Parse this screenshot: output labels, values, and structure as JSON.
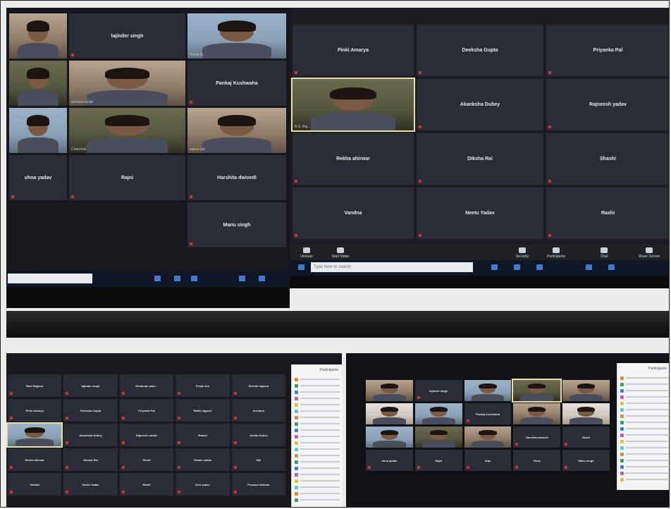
{
  "collage": {
    "top_left": {
      "tiles": [
        {
          "label": "",
          "video": true
        },
        {
          "label": "tajinder singh",
          "video": false
        },
        {
          "label": "",
          "video": true,
          "caption": "Vishal G..."
        },
        {
          "label": "",
          "video": true
        },
        {
          "label": "",
          "video": true,
          "caption": "archana singh"
        },
        {
          "label": "Pankaj Kushwaha",
          "video": false
        },
        {
          "label": "",
          "video": true
        },
        {
          "label": "",
          "video": true,
          "caption": "Chanchal"
        },
        {
          "label": "",
          "video": true,
          "caption": "sapna pal"
        },
        {
          "label": "uhna yadav",
          "video": false
        },
        {
          "label": "Rajni",
          "video": false
        },
        {
          "label": "Harshita dwivedi",
          "video": false
        },
        {
          "label": "",
          "video": false,
          "empty": true
        },
        {
          "label": "",
          "video": false,
          "empty": true
        },
        {
          "label": "Manu singh",
          "video": false
        }
      ]
    },
    "top_right": {
      "tiles": [
        {
          "label": "Pinki Amarya",
          "video": false
        },
        {
          "label": "Deeksha Gupta",
          "video": false
        },
        {
          "label": "Priyanka Pal",
          "video": false
        },
        {
          "label": "",
          "video": true,
          "selected": true,
          "caption": "B.S. Raj..."
        },
        {
          "label": "Akanksha Dubey",
          "video": false
        },
        {
          "label": "Rajneesh yadav",
          "video": false
        },
        {
          "label": "Rekha ahirwar",
          "video": false
        },
        {
          "label": "Diksha Rai",
          "video": false
        },
        {
          "label": "Shashi",
          "video": false
        },
        {
          "label": "Vandna",
          "video": false
        },
        {
          "label": "Neetu Yadav",
          "video": false
        },
        {
          "label": "Rashi",
          "video": false
        }
      ],
      "toolbar": [
        "Unmute",
        "Start Video",
        "Security",
        "Participants",
        "Chat",
        "Share Screen"
      ],
      "search_placeholder": "Type here to search"
    },
    "bottom_left": {
      "tiles": [
        {
          "label": "Ravi Rajpoot",
          "video": false
        },
        {
          "label": "tajinder singh",
          "video": false
        },
        {
          "label": "Himanshi yadv...",
          "video": false
        },
        {
          "label": "Pooja Jha",
          "video": false
        },
        {
          "label": "Shruthi rajpoot",
          "video": false
        },
        {
          "label": "Pinki Amarya",
          "video": false
        },
        {
          "label": "Deeksha Gupta",
          "video": false
        },
        {
          "label": "Priyanka Pal",
          "video": false
        },
        {
          "label": "Rakhi rajpoot",
          "video": false
        },
        {
          "label": "Archana",
          "video": false
        },
        {
          "label": "",
          "video": true,
          "selected": true
        },
        {
          "label": "Akanksha Dubey",
          "video": false
        },
        {
          "label": "Rajneesh yadav",
          "video": false
        },
        {
          "label": "Shashi",
          "video": false
        },
        {
          "label": "Ankita Dubey",
          "video": false
        },
        {
          "label": "Rekha ahirwar",
          "video": false
        },
        {
          "label": "Diksha Rai",
          "video": false
        },
        {
          "label": "Shruti",
          "video": false
        },
        {
          "label": "Vikash yadav",
          "video": false
        },
        {
          "label": "Niti",
          "video": false
        },
        {
          "label": "Vandna",
          "video": false
        },
        {
          "label": "Neetu Yadav",
          "video": false
        },
        {
          "label": "Rashi",
          "video": false
        },
        {
          "label": "Kirti yadav",
          "video": false
        },
        {
          "label": "Poonam ahirwar",
          "video": false
        }
      ],
      "panel_title": "Participants"
    },
    "bottom_right": {
      "tiles": [
        {
          "label": "",
          "video": true
        },
        {
          "label": "tajinder singh",
          "video": false
        },
        {
          "label": "",
          "video": true
        },
        {
          "label": "",
          "video": true,
          "selected": true
        },
        {
          "label": "",
          "video": true
        },
        {
          "label": "",
          "video": true
        },
        {
          "label": "",
          "video": true
        },
        {
          "label": "Pankaj Kushwaha",
          "video": false
        },
        {
          "label": "",
          "video": true
        },
        {
          "label": "",
          "video": true
        },
        {
          "label": "",
          "video": true
        },
        {
          "label": "",
          "video": true
        },
        {
          "label": "",
          "video": true
        },
        {
          "label": "Harshita dwivedi",
          "video": false
        },
        {
          "label": "Rashi",
          "video": false
        },
        {
          "label": "uhna yadav",
          "video": false
        },
        {
          "label": "Rajni",
          "video": false
        },
        {
          "label": "Anju",
          "video": false
        },
        {
          "label": "Vikas",
          "video": false
        },
        {
          "label": "Manu singh",
          "video": false
        }
      ],
      "panel_title": "Participants"
    }
  },
  "colors": {
    "tile": "#2a2d35",
    "toolbar": "#1f2127",
    "accent": "#2d8cff"
  }
}
